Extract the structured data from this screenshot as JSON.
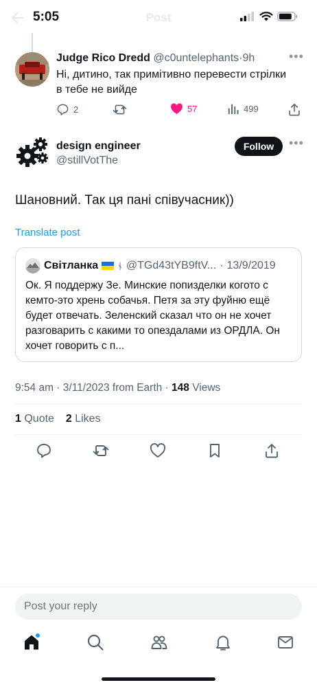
{
  "status": {
    "time": "5:05"
  },
  "header": {
    "title": "Post"
  },
  "reply": {
    "name": "Judge Rico Dredd",
    "handle": "@c0untelephants",
    "time": "9h",
    "text": "Ні, дитино, так примітивно перевести стрілки в тебе не вийде",
    "replies": "2",
    "likes": "57",
    "views": "499"
  },
  "tweet": {
    "author_name": "design engineer",
    "author_handle": "@stillVotThe",
    "follow_label": "Follow",
    "text": "Шановний. Так ця пані співучасник))",
    "translate_label": "Translate post",
    "timestamp": "9:54 am · 3/11/2023 from Earth · ",
    "views_count": "148",
    "views_label": " Views",
    "quotes_count": "1",
    "quotes_label": " Quote",
    "likes_count": "2",
    "likes_label": " Likes"
  },
  "quote": {
    "name": "Світланка",
    "extra_glyph": "ᚾ",
    "handle": "@TGd43tYB9ftV...",
    "date": "13/9/2019",
    "text": "Ок. Я поддержу Зе. Минские попизделки когото с кемто-это хрень собачья.  Петя за эту фуйню ещё будет отвечать. Зеленский сказал что он не хочет разговарить с какими то опездалами из ОРДЛА. Он хочет говорить с п..."
  },
  "composer": {
    "placeholder": "Post your reply"
  },
  "colors": {
    "accent": "#1d9bf0",
    "like": "#f91880",
    "text": "#0f1419",
    "muted": "#536471"
  },
  "icons": [
    "back-arrow-icon",
    "signal-icon",
    "wifi-icon",
    "battery-icon",
    "reply-icon",
    "retweet-icon",
    "heart-icon",
    "views-icon",
    "share-icon",
    "bookmark-icon",
    "home-icon",
    "search-icon",
    "communities-icon",
    "notifications-icon",
    "messages-icon"
  ]
}
